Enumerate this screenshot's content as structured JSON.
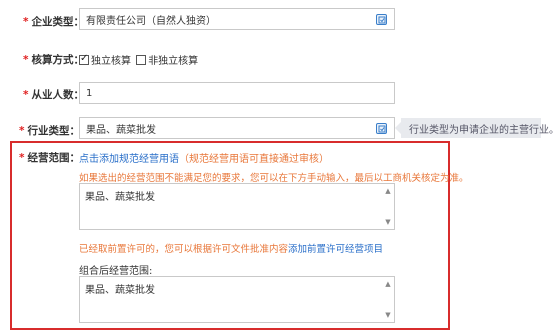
{
  "enterprise_type": {
    "label": "企业类型：",
    "value": "有限责任公司（自然人独资）"
  },
  "accounting": {
    "label": "核算方式：",
    "options": [
      {
        "label": "独立核算",
        "checked": true
      },
      {
        "label": "非独立核算",
        "checked": false
      }
    ]
  },
  "employees": {
    "label": "从业人数：",
    "value": "1"
  },
  "industry": {
    "label": "行业类型：",
    "value": "果品、蔬菜批发",
    "tip": "行业类型为申请企业的主营行业。"
  },
  "scope": {
    "label": "经营范围：",
    "link_add_standard": "点击添加规范经营用语",
    "link_hint": "（规范经营用语可直接通过审核）",
    "manual_hint": "如果选出的经营范围不能满足您的要求，您可以在下方手动输入，最后以工商机关核定为准。",
    "manual_value": "果品、蔬菜批发",
    "permit_hint": "已经取前置许可的，您可以根据许可文件批准内容",
    "permit_link": "添加前置许可经营项目",
    "combined_label": "组合后经营范围:",
    "combined_value": "果品、蔬菜批发"
  },
  "colors": {
    "required": "#e02020",
    "link": "#2a6fc9",
    "hint": "#e8773a",
    "highlight_border": "#d82c2c"
  }
}
